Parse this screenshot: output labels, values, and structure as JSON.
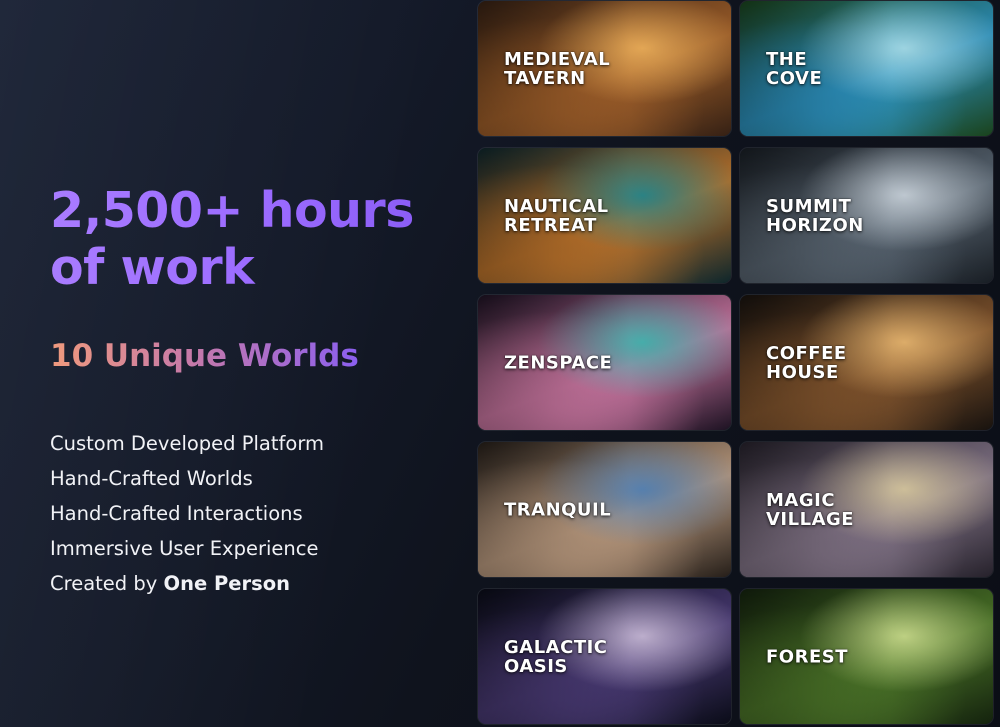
{
  "headline": {
    "line1": "2,500+ hours",
    "line2": "of work"
  },
  "subhead": "10 Unique Worlds",
  "features": [
    "Custom Developed Platform",
    "Hand-Crafted Worlds",
    "Hand-Crafted Interactions",
    "Immersive User Experience"
  ],
  "credit": {
    "prefix": "Created by ",
    "emphasis": "One Person"
  },
  "worlds": [
    {
      "label": "MEDIEVAL\nTAVERN",
      "palette": [
        "#3b2416",
        "#a8642c",
        "#f0b05a"
      ]
    },
    {
      "label": "THE\nCOVE",
      "palette": [
        "#1d4a1f",
        "#2f9ac9",
        "#a6e0ee"
      ]
    },
    {
      "label": "NAUTICAL\nRETREAT",
      "palette": [
        "#0f2a30",
        "#c77a2e",
        "#2e8a8c"
      ]
    },
    {
      "label": "SUMMIT\nHORIZON",
      "palette": [
        "#1b2128",
        "#5e6b78",
        "#c9d3dc"
      ]
    },
    {
      "label": "ZENSPACE",
      "palette": [
        "#201426",
        "#d47ca9",
        "#4ab7b4"
      ]
    },
    {
      "label": "COFFEE\nHOUSE",
      "palette": [
        "#1a1410",
        "#8a5a30",
        "#e9b66f"
      ]
    },
    {
      "label": "TRANQUIL",
      "palette": [
        "#2a221c",
        "#c6a487",
        "#5b87b8"
      ]
    },
    {
      "label": "MAGIC\nVILLAGE",
      "palette": [
        "#2a2530",
        "#8a7b8f",
        "#d9c9a2"
      ]
    },
    {
      "label": "GALACTIC\nOASIS",
      "palette": [
        "#0b0d1a",
        "#4d3d7a",
        "#c7b8d8"
      ]
    },
    {
      "label": "FOREST",
      "palette": [
        "#16260f",
        "#4f7a2a",
        "#c8dc8a"
      ]
    }
  ]
}
